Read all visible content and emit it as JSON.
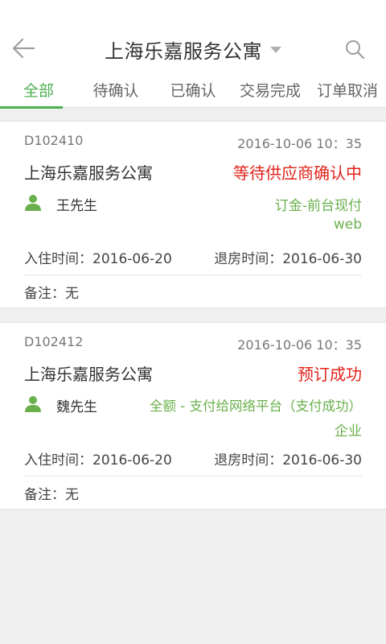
{
  "header": {
    "title": "上海乐嘉服务公寓",
    "back_icon": "back-arrow-icon",
    "dropdown_icon": "caret-down-icon",
    "search_icon": "search-icon"
  },
  "tabs": [
    {
      "label": "全部",
      "active": true
    },
    {
      "label": "待确认",
      "active": false
    },
    {
      "label": "已确认",
      "active": false
    },
    {
      "label": "交易完成",
      "active": false
    },
    {
      "label": "订单取消",
      "active": false
    }
  ],
  "orders": [
    {
      "order_no": "D102410",
      "time": "2016-10-06 10：35",
      "hotel": "上海乐嘉服务公寓",
      "status": "等待供应商确认中",
      "guest": "王先生",
      "payment": "订金-前台现付",
      "channel": "web",
      "checkin": "入住时间：2016-06-20",
      "checkout": "退房时间：2016-06-30",
      "note": "备注：无"
    },
    {
      "order_no": "D102412",
      "time": "2016-10-06 10：35",
      "hotel": "上海乐嘉服务公寓",
      "status": "预订成功",
      "guest": "魏先生",
      "payment": "全额 - 支付给网络平台（支付成功）",
      "channel": "企业",
      "checkin": "入住时间：2016-06-20",
      "checkout": "退房时间：2016-06-30",
      "note": "备注：无"
    }
  ],
  "colors": {
    "accent": "#4caf50",
    "status_red": "#e2231a",
    "pay_green": "#6ab04c"
  }
}
